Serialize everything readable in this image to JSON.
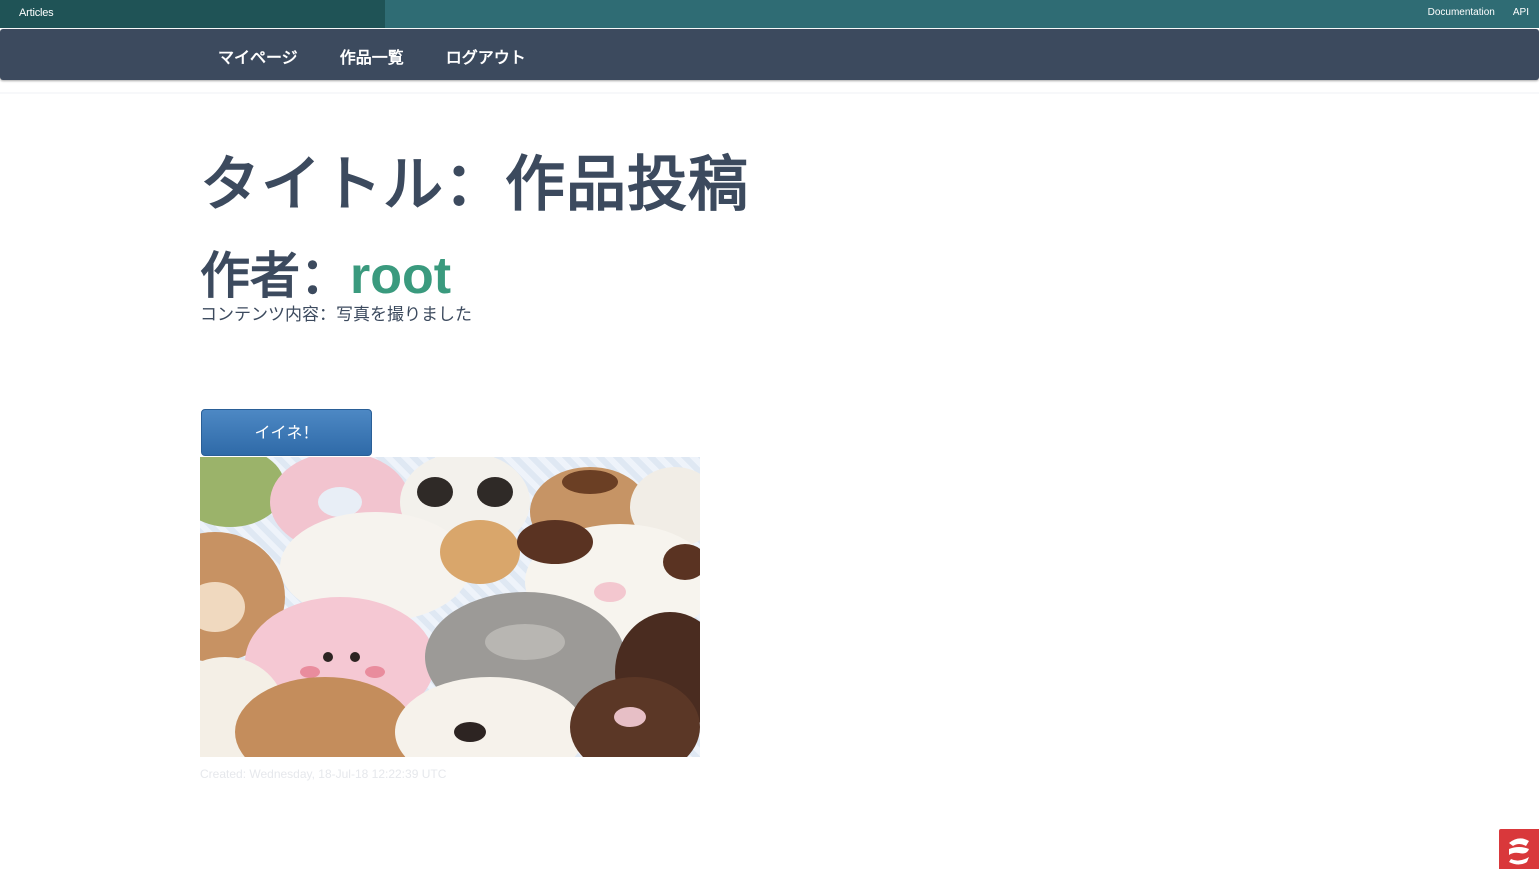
{
  "topbar": {
    "brand": "Articles",
    "links": [
      "Documentation",
      "API"
    ]
  },
  "navbar": {
    "items": [
      "マイページ",
      "作品一覧",
      "ログアウト"
    ]
  },
  "article": {
    "title": "タイトル：作品投稿",
    "author_label": "作者：",
    "author_name": "root",
    "content": "コンテンツ内容：写真を撮りました",
    "like_button": "イイネ！",
    "created": "Created: Wednesday, 18-Jul-18 12:22:39 UTC",
    "photo_subject": "animal-shaped decorated donuts"
  },
  "colors": {
    "topbar": "#2f6c74",
    "navbar": "#3c4a5e",
    "author_accent": "#3a9a7e",
    "button": "#3a78b8"
  },
  "icons": {
    "corner": "app-logo-icon"
  }
}
